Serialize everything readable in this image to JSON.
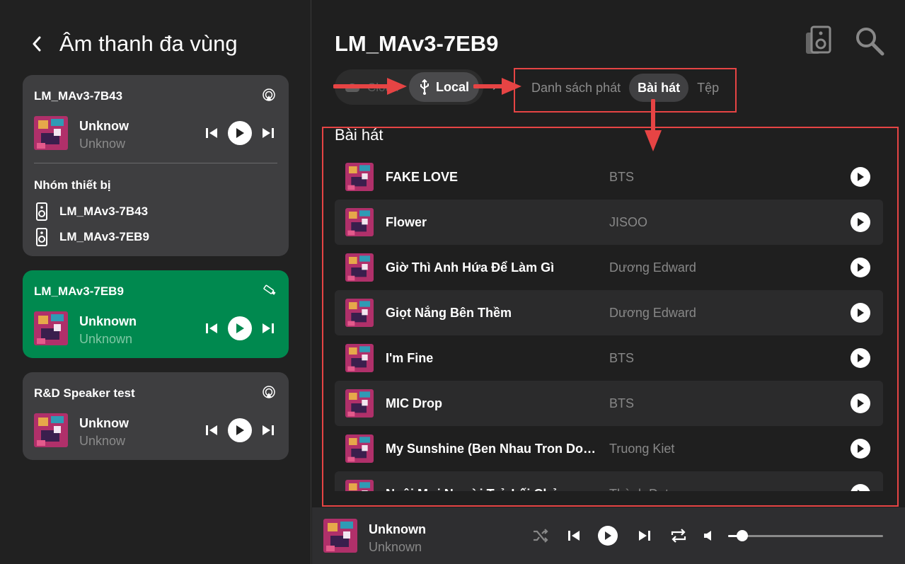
{
  "left": {
    "title": "Âm thanh đa vùng",
    "cards": [
      {
        "name": "LM_MAv3-7B43",
        "track_title": "Unknow",
        "track_sub": "Unknow",
        "status_icon": "airplay-icon",
        "active": false,
        "group": {
          "label": "Nhóm thiết bị",
          "devices": [
            "LM_MAv3-7B43",
            "LM_MAv3-7EB9"
          ]
        }
      },
      {
        "name": "LM_MAv3-7EB9",
        "track_title": "Unknown",
        "track_sub": "Unknown",
        "status_icon": "usb-stick-icon",
        "active": true
      },
      {
        "name": "R&D Speaker test",
        "track_title": "Unknow",
        "track_sub": "Unknow",
        "status_icon": "airplay-icon",
        "active": false
      }
    ]
  },
  "main": {
    "device_title": "LM_MAv3-7EB9",
    "source_cloud": "Cloud",
    "source_local": "Local",
    "tabs": [
      {
        "label": "Danh sách phát",
        "selected": false
      },
      {
        "label": "Bài hát",
        "selected": true
      },
      {
        "label": "Tệp",
        "selected": false
      }
    ],
    "section_title": "Bài hát",
    "songs": [
      {
        "title": "FAKE LOVE",
        "artist": "BTS"
      },
      {
        "title": "Flower",
        "artist": "JISOO"
      },
      {
        "title": "Giờ Thì Anh Hứa Để Làm Gì",
        "artist": "Dương Edward"
      },
      {
        "title": "Giọt Nắng Bên Thềm",
        "artist": "Dương Edward"
      },
      {
        "title": "I'm Fine",
        "artist": "BTS"
      },
      {
        "title": "MIC Drop",
        "artist": "BTS"
      },
      {
        "title": "My Sunshine (Ben Nhau Tron Doi Nhe)",
        "artist": "Truong Kiet"
      },
      {
        "title": "Nuôi Mơi Người Trở Lối Chở",
        "artist": "Thành Đạt"
      }
    ]
  },
  "player": {
    "title": "Unknown",
    "subtitle": "Unknown",
    "volume": 0.09
  },
  "colors": {
    "accent_green": "#00894f",
    "annotation_red": "#e64444",
    "card_bg": "#3e3e40"
  }
}
